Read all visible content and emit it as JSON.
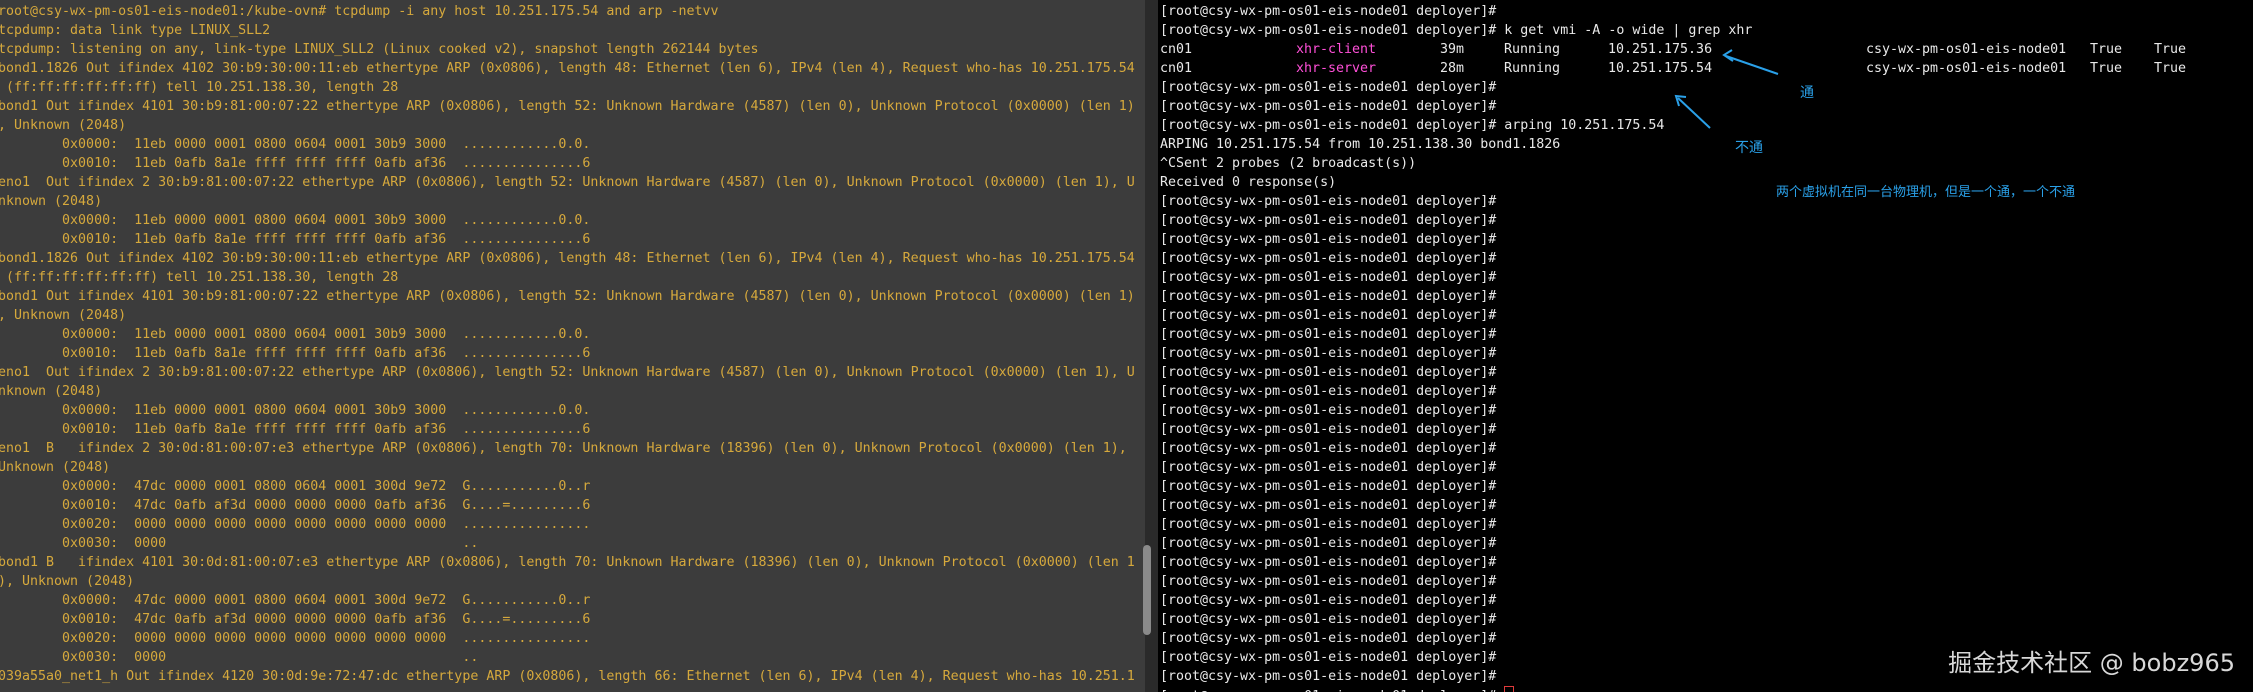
{
  "left_terminal": {
    "lines": [
      "root@csy-wx-pm-os01-eis-node01:/kube-ovn# tcpdump -i any host 10.251.175.54 and arp -netvv",
      "tcpdump: data link type LINUX_SLL2",
      "tcpdump: listening on any, link-type LINUX_SLL2 (Linux cooked v2), snapshot length 262144 bytes",
      "bond1.1826 Out ifindex 4102 30:b9:30:00:11:eb ethertype ARP (0x0806), length 48: Ethernet (len 6), IPv4 (len 4), Request who-has 10.251.175.54",
      " (ff:ff:ff:ff:ff:ff) tell 10.251.138.30, length 28",
      "bond1 Out ifindex 4101 30:b9:81:00:07:22 ethertype ARP (0x0806), length 52: Unknown Hardware (4587) (len 0), Unknown Protocol (0x0000) (len 1)",
      ", Unknown (2048)",
      "        0x0000:  11eb 0000 0001 0800 0604 0001 30b9 3000  ............0.0.",
      "        0x0010:  11eb 0afb 8a1e ffff ffff ffff 0afb af36  ...............6",
      "eno1  Out ifindex 2 30:b9:81:00:07:22 ethertype ARP (0x0806), length 52: Unknown Hardware (4587) (len 0), Unknown Protocol (0x0000) (len 1), U",
      "nknown (2048)",
      "        0x0000:  11eb 0000 0001 0800 0604 0001 30b9 3000  ............0.0.",
      "        0x0010:  11eb 0afb 8a1e ffff ffff ffff 0afb af36  ...............6",
      "bond1.1826 Out ifindex 4102 30:b9:30:00:11:eb ethertype ARP (0x0806), length 48: Ethernet (len 6), IPv4 (len 4), Request who-has 10.251.175.54",
      " (ff:ff:ff:ff:ff:ff) tell 10.251.138.30, length 28",
      "bond1 Out ifindex 4101 30:b9:81:00:07:22 ethertype ARP (0x0806), length 52: Unknown Hardware (4587) (len 0), Unknown Protocol (0x0000) (len 1)",
      ", Unknown (2048)",
      "        0x0000:  11eb 0000 0001 0800 0604 0001 30b9 3000  ............0.0.",
      "        0x0010:  11eb 0afb 8a1e ffff ffff ffff 0afb af36  ...............6",
      "eno1  Out ifindex 2 30:b9:81:00:07:22 ethertype ARP (0x0806), length 52: Unknown Hardware (4587) (len 0), Unknown Protocol (0x0000) (len 1), U",
      "nknown (2048)",
      "        0x0000:  11eb 0000 0001 0800 0604 0001 30b9 3000  ............0.0.",
      "        0x0010:  11eb 0afb 8a1e ffff ffff ffff 0afb af36  ...............6",
      "eno1  B   ifindex 2 30:0d:81:00:07:e3 ethertype ARP (0x0806), length 70: Unknown Hardware (18396) (len 0), Unknown Protocol (0x0000) (len 1),",
      "Unknown (2048)",
      "        0x0000:  47dc 0000 0001 0800 0604 0001 300d 9e72  G...........0..r",
      "        0x0010:  47dc 0afb af3d 0000 0000 0000 0afb af36  G....=.........6",
      "        0x0020:  0000 0000 0000 0000 0000 0000 0000 0000  ................",
      "        0x0030:  0000                                     ..",
      "bond1 B   ifindex 4101 30:0d:81:00:07:e3 ethertype ARP (0x0806), length 70: Unknown Hardware (18396) (len 0), Unknown Protocol (0x0000) (len 1",
      "), Unknown (2048)",
      "        0x0000:  47dc 0000 0001 0800 0604 0001 300d 9e72  G...........0..r",
      "        0x0010:  47dc 0afb af3d 0000 0000 0000 0afb af36  G....=.........6",
      "        0x0020:  0000 0000 0000 0000 0000 0000 0000 0000  ................",
      "        0x0030:  0000                                     ..",
      "039a55a0_net1_h Out ifindex 4120 30:0d:9e:72:47:dc ethertype ARP (0x0806), length 66: Ethernet (len 6), IPv4 (len 4), Request who-has 10.251.1"
    ]
  },
  "right_terminal": {
    "prompt": "[root@csy-wx-pm-os01-eis-node01 deployer]#",
    "command": "k get vmi -A -o wide | grep xhr",
    "vmi_rows": [
      {
        "ns": "cn01",
        "name": "xhr-client",
        "age": "39m",
        "phase": "Running",
        "ip": "10.251.175.36",
        "node": "csy-wx-pm-os01-eis-node01",
        "ready": "True",
        "live": "True"
      },
      {
        "ns": "cn01",
        "name": "xhr-server",
        "age": "28m",
        "phase": "Running",
        "ip": "10.251.175.54",
        "node": "csy-wx-pm-os01-eis-node01",
        "ready": "True",
        "live": "True"
      }
    ],
    "arping_cmd": "arping 10.251.175.54",
    "arping_out": "ARPING 10.251.175.54 from 10.251.138.30 bond1.1826",
    "sent_line": "^CSent 2 probes (2 broadcast(s))",
    "recv_line": "Received 0 response(s)",
    "trailing_prompts": 26
  },
  "annotations": {
    "ok": "通",
    "fail": "不通",
    "note": "两个虚拟机在同一台物理机，但是一个通，一个不通",
    "color": "#2aa0e8"
  },
  "watermark": "掘金技术社区 @ bobz965"
}
